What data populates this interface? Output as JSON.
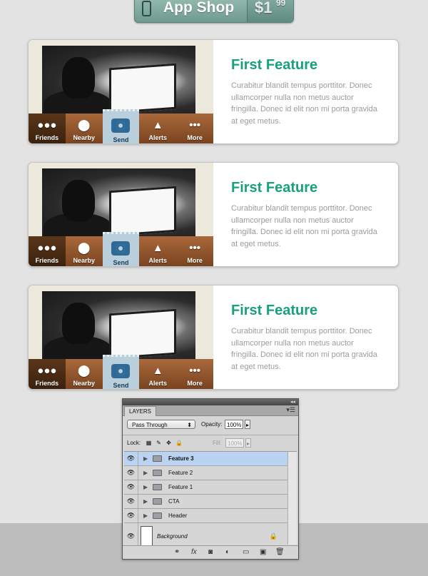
{
  "app_shop": {
    "label": "App Shop",
    "price_main": "$1",
    "price_cents": "99",
    "icon": "phone-icon"
  },
  "features": [
    {
      "title": "First Feature",
      "description": "Curabitur blandit tempus porttitor. Donec ullamcorper nulla non metus auctor fringilla. Donec id elit non mi porta gravida at eget metus.",
      "tabs": [
        "Friends",
        "Nearby",
        "Send",
        "Alerts",
        "More"
      ]
    },
    {
      "title": "First Feature",
      "description": "Curabitur blandit tempus porttitor. Donec ullamcorper nulla non metus auctor fringilla. Donec id elit non mi porta gravida at eget metus.",
      "tabs": [
        "Friends",
        "Nearby",
        "Send",
        "Alerts",
        "More"
      ]
    },
    {
      "title": "First Feature",
      "description": "Curabitur blandit tempus porttitor. Donec ullamcorper nulla non metus auctor fringilla. Donec id elit non mi porta gravida at eget metus.",
      "tabs": [
        "Friends",
        "Nearby",
        "Send",
        "Alerts",
        "More"
      ]
    }
  ],
  "layers_panel": {
    "tab": "LAYERS",
    "blend_mode": "Pass Through",
    "opacity_label": "Opacity:",
    "opacity_value": "100%",
    "lock_label": "Lock:",
    "fill_label": "Fill:",
    "fill_value": "100%",
    "layers": [
      "Feature 3",
      "Feature 2",
      "Feature 1",
      "CTA",
      "Header"
    ],
    "background": "Background",
    "selected_layer": "Feature 3"
  },
  "colors": {
    "accent_green": "#18a17d",
    "selected_layer": "#b9d3f0",
    "wood": "#a9683a"
  }
}
